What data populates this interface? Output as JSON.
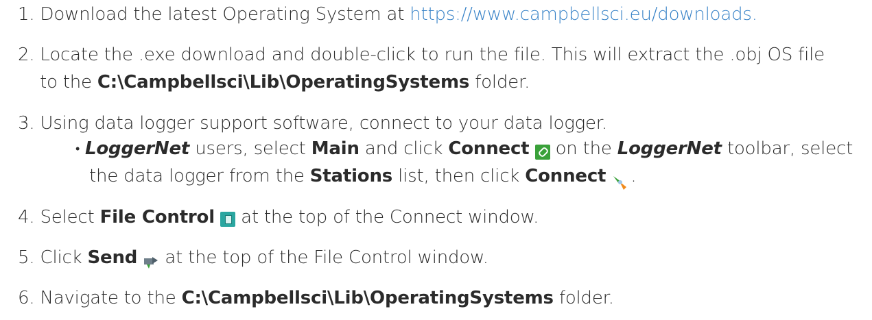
{
  "steps": {
    "s1": {
      "num": "1.",
      "text": "Download the latest Operating System at ",
      "link": "https://www.campbellsci.eu/downloads."
    },
    "s2": {
      "num": "2.",
      "text1": "Locate the .exe download and double-click to run the file. This will extract the .obj OS file",
      "text2a": "to the ",
      "path": "C:\\Campbellsci\\Lib\\OperatingSystems",
      "text2b": " folder."
    },
    "s3": {
      "num": "3.",
      "text": "Using data logger support software, connect to your data logger.",
      "bullet": {
        "product1": "LoggerNet",
        "t1": " users, select ",
        "main": "Main",
        "t2": " and click ",
        "connect1": "Connect",
        "t3": " on the ",
        "product2": "LoggerNet",
        "t4": " toolbar, select",
        "t5": "the data logger from the ",
        "stations": "Stations",
        "t6": " list, then click ",
        "connect2": "Connect",
        "t7": "."
      }
    },
    "s4": {
      "num": "4.",
      "t1": "Select ",
      "file_control": "File Control",
      "t2": " at the top of the Connect window."
    },
    "s5": {
      "num": "5.",
      "t1": "Click ",
      "send": "Send",
      "t2": " at the top of the File Control window."
    },
    "s6": {
      "num": "6.",
      "t1": "Navigate to the ",
      "path": "C:\\Campbellsci\\Lib\\OperatingSystems",
      "t2": " folder."
    }
  },
  "icons": [
    "connect-icon",
    "connect-plug-icon",
    "file-control-icon",
    "send-icon"
  ],
  "colors": {
    "text": "#2b2b2b",
    "link": "#3a84c8",
    "connect_icon": "#3aa13a",
    "file_icon": "#2aa6a0"
  }
}
